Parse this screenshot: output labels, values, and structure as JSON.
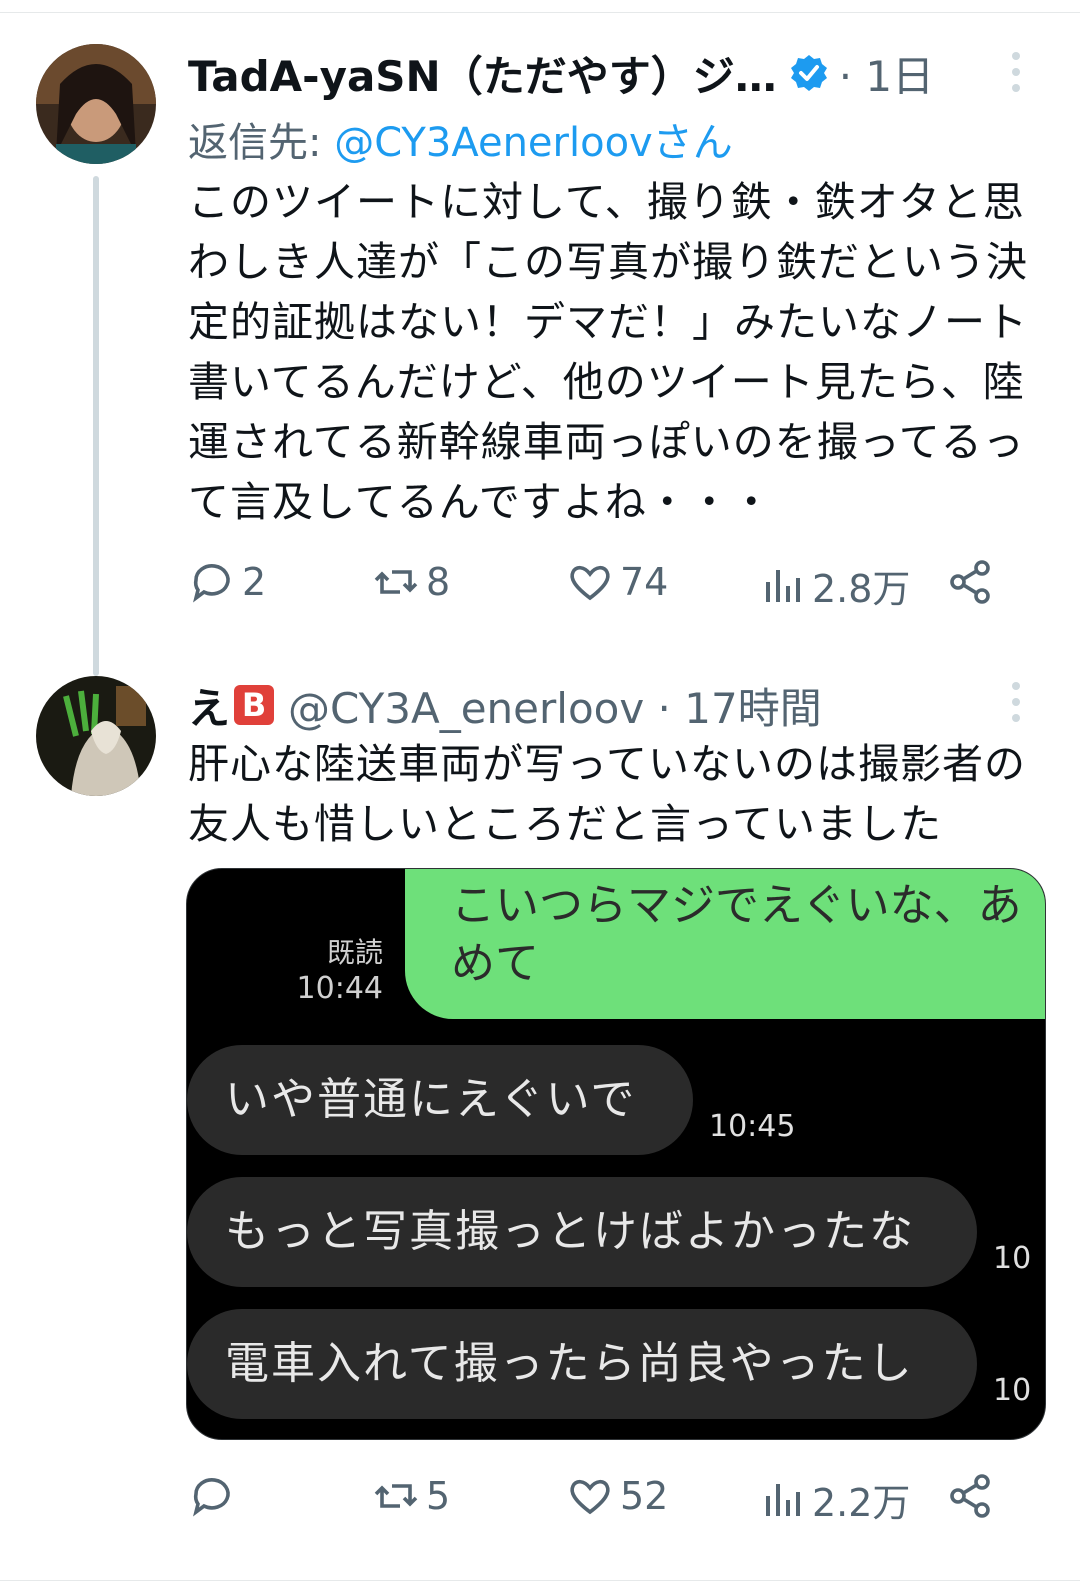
{
  "tweets": [
    {
      "name": "TadA-yaSN（ただやす）ジ…",
      "dot_time": "· 1日",
      "reply_prefix": "返信先: ",
      "reply_handle": "@CY3Aenerloovさん",
      "text": "このツイートに対して、撮り鉄・鉄オタと思わしき人達が「この写真が撮り鉄だという決定的証拠はない！デマだ！」みたいなノート書いてるんだけど、他のツイート見たら、陸運されてる新幹線車両っぽいのを撮ってるって言及してるんですよね・・・",
      "reply_count": "2",
      "retweet_count": "8",
      "like_count": "74",
      "view_count": "2.8万"
    },
    {
      "name": "え",
      "badge": "B",
      "handle_time": "@CY3A_enerloov · 17時間",
      "text": "肝心な陸送車両が写っていないのは撮影者の友人も惜しいところだと言っていました",
      "reply_count": "",
      "retweet_count": "5",
      "like_count": "52",
      "view_count": "2.2万"
    }
  ],
  "chat": {
    "green_line1": "こいつらマジでえぐいな、あ",
    "green_line2": "めて",
    "read_label": "既読",
    "read_time": "10:44",
    "msg1": "いや普通にえぐいで",
    "msg1_time": "10:45",
    "msg2": "もっと写真撮っとけばよかったな",
    "msg2_time": "10",
    "msg3": "電車入れて撮ったら尚良やったし",
    "msg3_time": "10"
  },
  "colors": {
    "link": "#1d9bf0",
    "muted": "#536471",
    "verified": "#1d9bf0",
    "chat_green": "#6ee07a"
  },
  "icons": [
    "reply-icon",
    "retweet-icon",
    "like-icon",
    "views-icon",
    "share-icon",
    "verified-icon",
    "more-icon"
  ]
}
